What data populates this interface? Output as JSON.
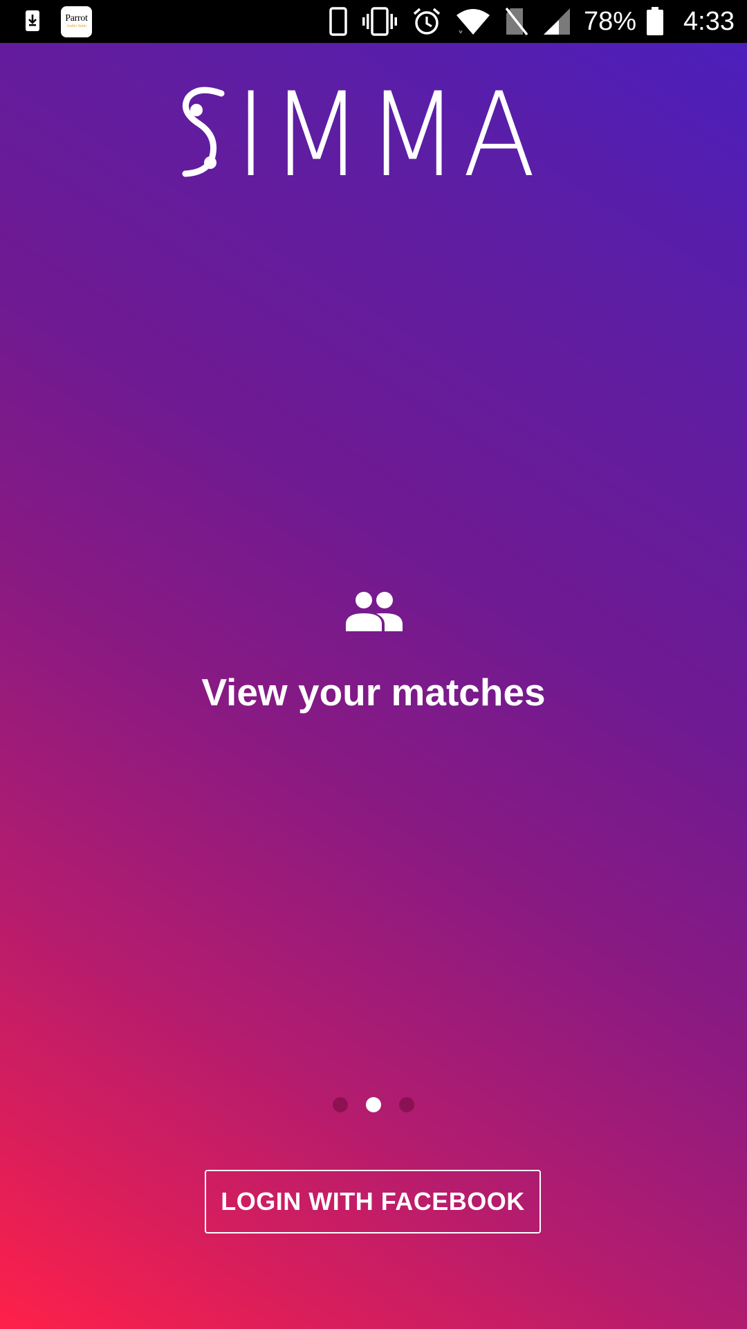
{
  "status_bar": {
    "left_icons": [
      "download-icon",
      "parrot-audio-suite-icon"
    ],
    "parrot_icon_text": "Parrot",
    "parrot_icon_subtext": "Audio Suite",
    "right_icons": [
      "phone-icon",
      "vibrate-icon",
      "alarm-icon",
      "wifi-icon",
      "no-sim-icon",
      "cell-signal-icon",
      "battery-icon"
    ],
    "battery_percent": "78%",
    "time": "4:33"
  },
  "app": {
    "logo_text": "IMMA",
    "logo_full": "SIMMA"
  },
  "slide": {
    "icon": "people-icon",
    "title": "View your matches"
  },
  "pager": {
    "total": 3,
    "active_index": 1
  },
  "login": {
    "button_label": "LOGIN WITH FACEBOOK"
  },
  "colors": {
    "gradient_top": "#4a1fbf",
    "gradient_mid": "#8a1a82",
    "gradient_bottom": "#ff2049",
    "text": "#ffffff"
  }
}
